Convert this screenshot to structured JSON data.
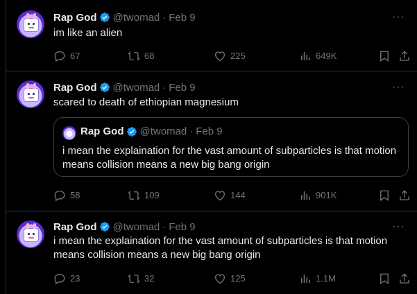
{
  "tweets": [
    {
      "name": "Rap God",
      "handle": "@twomad",
      "sep": "·",
      "date": "Feb 9",
      "text": "im like an alien",
      "more": "···",
      "replies": "67",
      "retweets": "68",
      "likes": "225",
      "views": "649K"
    },
    {
      "name": "Rap God",
      "handle": "@twomad",
      "sep": "·",
      "date": "Feb 9",
      "text": "scared to death of ethiopian magnesium",
      "more": "···",
      "quote": {
        "name": "Rap God",
        "handle": "@twomad",
        "sep": "·",
        "date": "Feb 9",
        "text": "i mean the explaination for the vast amount of subparticles is that motion means collision means a new big bang origin"
      },
      "replies": "58",
      "retweets": "109",
      "likes": "144",
      "views": "901K"
    },
    {
      "name": "Rap God",
      "handle": "@twomad",
      "sep": "·",
      "date": "Feb 9",
      "text": "i mean the explaination for the vast amount of subparticles is that motion means collision means a new big bang origin",
      "more": "···",
      "replies": "23",
      "retweets": "32",
      "likes": "125",
      "views": "1.1M"
    }
  ],
  "colors": {
    "background": "#000000",
    "text": "#e7e9ea",
    "muted": "#71767b",
    "verified": "#1d9bf0",
    "border": "#2f3336"
  }
}
